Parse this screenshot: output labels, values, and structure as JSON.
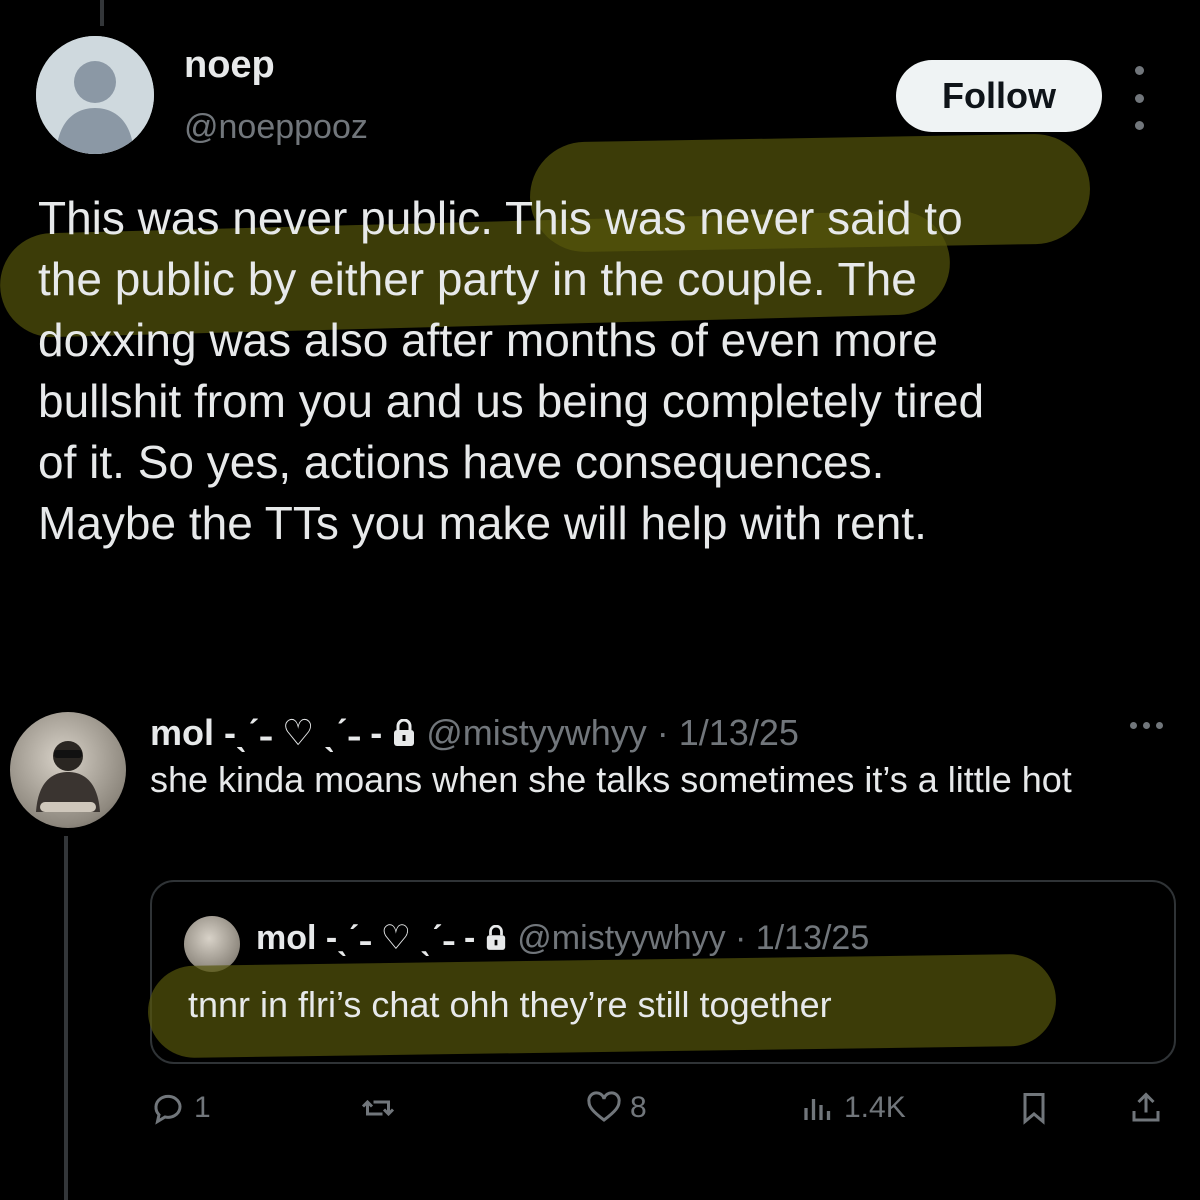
{
  "tweet": {
    "display_name": "noep",
    "handle": "@noeppooz",
    "follow_label": "Follow",
    "avatar_icon": "default-avatar-icon",
    "body": "This was never public. This was never said to\nthe public by either party in the couple. The\ndoxxing was also after months of even more\nbullshit from you and us being completely tired\nof it. So yes, actions have consequences.\nMaybe the TTs you make will help with rent."
  },
  "reply": {
    "name": "mol -ˎˊ˗ ♡ ˎˊ˗ -",
    "handle_date": "@mistyywhyy · 1/13/25",
    "text": "she kinda moans when she talks sometimes it’s a little hot",
    "quote": {
      "name": "mol -ˎˊ˗ ♡ ˎˊ˗ -",
      "handle_date": "@mistyywhyy · 1/13/25",
      "text": "tnnr in flri’s chat ohh they’re still together"
    },
    "actions": {
      "replies": "1",
      "retweets": "",
      "likes": "8",
      "views": "1.4K"
    }
  },
  "colors": {
    "background": "#000000",
    "text": "#e7e9ea",
    "muted": "#71767b",
    "highlight": "#56560c"
  }
}
